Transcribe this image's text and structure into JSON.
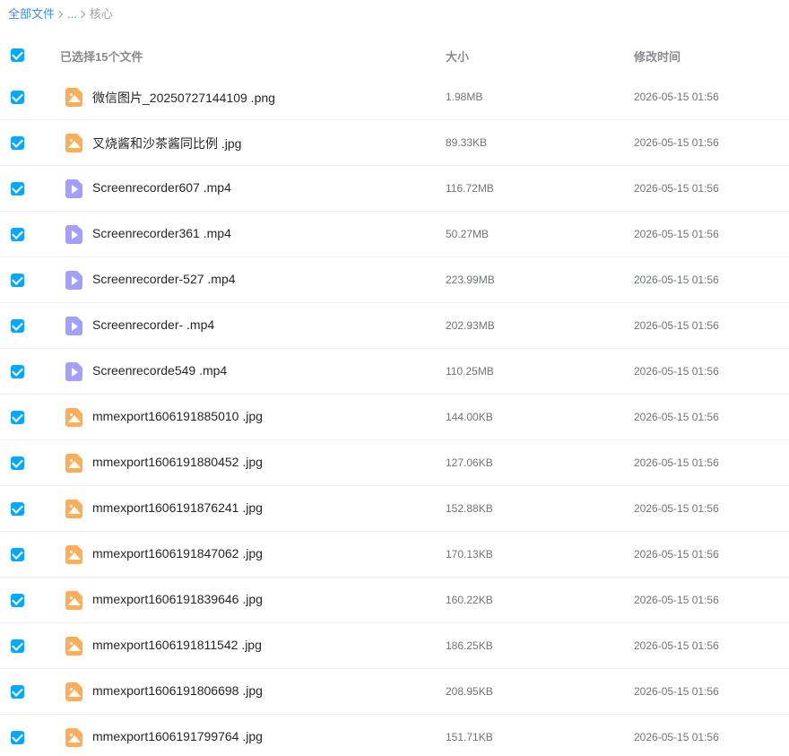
{
  "breadcrumb": {
    "root": "全部文件",
    "ellipsis": "...",
    "current": "核心"
  },
  "header": {
    "selected_label": "已选择15个文件",
    "size_label": "大小",
    "time_label": "修改时间"
  },
  "colors": {
    "accent": "#06a7ff",
    "link": "#3b8cf7",
    "image_icon": "#fcae5a",
    "video_icon": "#a3a0fb"
  },
  "files": [
    {
      "name": "微信图片_20250727144109 .png",
      "size": "1.98MB",
      "time": "2026-05-15 01:56",
      "icon": "image-file-icon",
      "checked": true
    },
    {
      "name": "叉烧酱和沙茶酱同比例 .jpg",
      "size": "89.33KB",
      "time": "2026-05-15 01:56",
      "icon": "image-file-icon",
      "checked": true
    },
    {
      "name": "Screenrecorder607 .mp4",
      "size": "116.72MB",
      "time": "2026-05-15 01:56",
      "icon": "video-file-icon",
      "checked": true
    },
    {
      "name": "Screenrecorder361 .mp4",
      "size": "50.27MB",
      "time": "2026-05-15 01:56",
      "icon": "video-file-icon",
      "checked": true
    },
    {
      "name": "Screenrecorder-527 .mp4",
      "size": "223.99MB",
      "time": "2026-05-15 01:56",
      "icon": "video-file-icon",
      "checked": true
    },
    {
      "name": "Screenrecorder- .mp4",
      "size": "202.93MB",
      "time": "2026-05-15 01:56",
      "icon": "video-file-icon",
      "checked": true
    },
    {
      "name": "Screenrecorde549 .mp4",
      "size": "110.25MB",
      "time": "2026-05-15 01:56",
      "icon": "video-file-icon",
      "checked": true
    },
    {
      "name": "mmexport1606191885010 .jpg",
      "size": "144.00KB",
      "time": "2026-05-15 01:56",
      "icon": "image-file-icon",
      "checked": true
    },
    {
      "name": "mmexport1606191880452 .jpg",
      "size": "127.06KB",
      "time": "2026-05-15 01:56",
      "icon": "image-file-icon",
      "checked": true
    },
    {
      "name": "mmexport1606191876241 .jpg",
      "size": "152.88KB",
      "time": "2026-05-15 01:56",
      "icon": "image-file-icon",
      "checked": true
    },
    {
      "name": "mmexport1606191847062 .jpg",
      "size": "170.13KB",
      "time": "2026-05-15 01:56",
      "icon": "image-file-icon",
      "checked": true
    },
    {
      "name": "mmexport1606191839646 .jpg",
      "size": "160.22KB",
      "time": "2026-05-15 01:56",
      "icon": "image-file-icon",
      "checked": true
    },
    {
      "name": "mmexport1606191811542 .jpg",
      "size": "186.25KB",
      "time": "2026-05-15 01:56",
      "icon": "image-file-icon",
      "checked": true
    },
    {
      "name": "mmexport1606191806698 .jpg",
      "size": "208.95KB",
      "time": "2026-05-15 01:56",
      "icon": "image-file-icon",
      "checked": true
    },
    {
      "name": "mmexport1606191799764 .jpg",
      "size": "151.71KB",
      "time": "2026-05-15 01:56",
      "icon": "image-file-icon",
      "checked": true
    }
  ]
}
